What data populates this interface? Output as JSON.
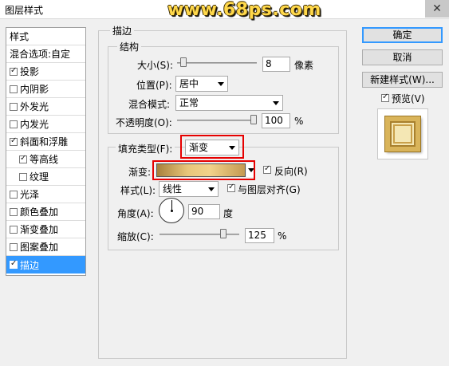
{
  "window": {
    "title": "图层样式",
    "watermark": "www.68ps.com",
    "close": "✕"
  },
  "sidebar": {
    "header": "样式",
    "blend_options": "混合选项:自定",
    "items": [
      {
        "label": "投影",
        "checked": true
      },
      {
        "label": "内阴影",
        "checked": false
      },
      {
        "label": "外发光",
        "checked": false
      },
      {
        "label": "内发光",
        "checked": false
      },
      {
        "label": "斜面和浮雕",
        "checked": true
      },
      {
        "label": "等高线",
        "checked": true
      },
      {
        "label": "纹理",
        "checked": false
      },
      {
        "label": "光泽",
        "checked": false
      },
      {
        "label": "颜色叠加",
        "checked": false
      },
      {
        "label": "渐变叠加",
        "checked": false
      },
      {
        "label": "图案叠加",
        "checked": false
      },
      {
        "label": "描边",
        "checked": true
      }
    ]
  },
  "stroke": {
    "title": "描边",
    "structure_title": "结构",
    "size_label": "大小(S):",
    "size_value": "8",
    "size_unit": "像素",
    "position_label": "位置(P):",
    "position_value": "居中",
    "blend_label": "混合模式:",
    "blend_value": "正常",
    "opacity_label": "不透明度(O):",
    "opacity_value": "100",
    "opacity_unit": "%"
  },
  "fill": {
    "type_label": "填充类型(F):",
    "type_value": "渐变",
    "gradient_label": "渐变:",
    "reverse_label": "反向(R)",
    "reverse_checked": true,
    "style_label": "样式(L):",
    "style_value": "线性",
    "align_label": "与图层对齐(G)",
    "align_checked": true,
    "angle_label": "角度(A):",
    "angle_value": "90",
    "angle_unit": "度",
    "scale_label": "缩放(C):",
    "scale_value": "125",
    "scale_unit": "%"
  },
  "buttons": {
    "ok": "确定",
    "cancel": "取消",
    "new_style": "新建样式(W)...",
    "preview_label": "预览(V)",
    "preview_checked": true
  },
  "colors": {
    "selection": "#3399ff",
    "highlight": "#e60000"
  }
}
